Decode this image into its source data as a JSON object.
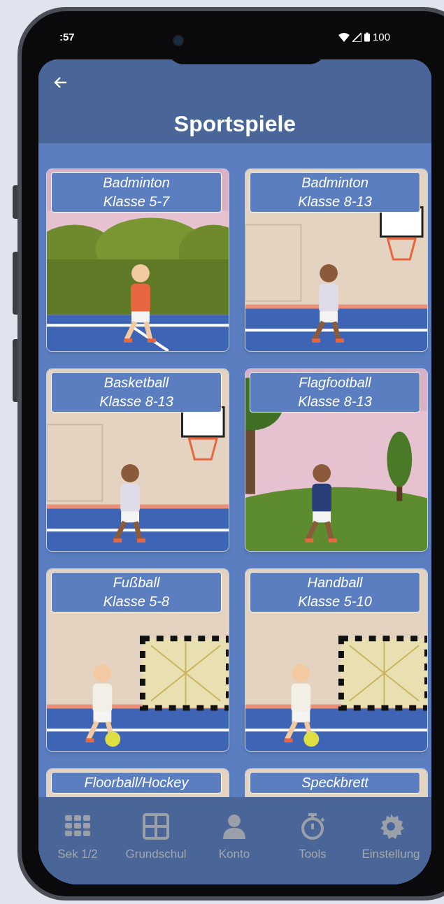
{
  "status_bar": {
    "time": ":57",
    "battery": "100"
  },
  "header": {
    "title": "Sportspiele"
  },
  "cards": [
    {
      "title": "Badminton",
      "grades": "Klasse 5-7",
      "kind": "outdoor"
    },
    {
      "title": "Badminton",
      "grades": "Klasse 8-13",
      "kind": "gym"
    },
    {
      "title": "Basketball",
      "grades": "Klasse 8-13",
      "kind": "gym"
    },
    {
      "title": "Flagfootball",
      "grades": "Klasse 8-13",
      "kind": "park"
    },
    {
      "title": "Fußball",
      "grades": "Klasse 5-8",
      "kind": "goal"
    },
    {
      "title": "Handball",
      "grades": "Klasse 5-10",
      "kind": "goal"
    },
    {
      "title": "Floorball/Hockey",
      "kind": "gym"
    },
    {
      "title": "Speckbrett",
      "kind": "gym"
    }
  ],
  "nav": [
    {
      "label": "Sek 1/2",
      "kind": "dots"
    },
    {
      "label": "Grundschul",
      "kind": "grid"
    },
    {
      "label": "Konto",
      "kind": "person"
    },
    {
      "label": "Tools",
      "kind": "stopwatch"
    },
    {
      "label": "Einstellung",
      "kind": "gear"
    }
  ]
}
